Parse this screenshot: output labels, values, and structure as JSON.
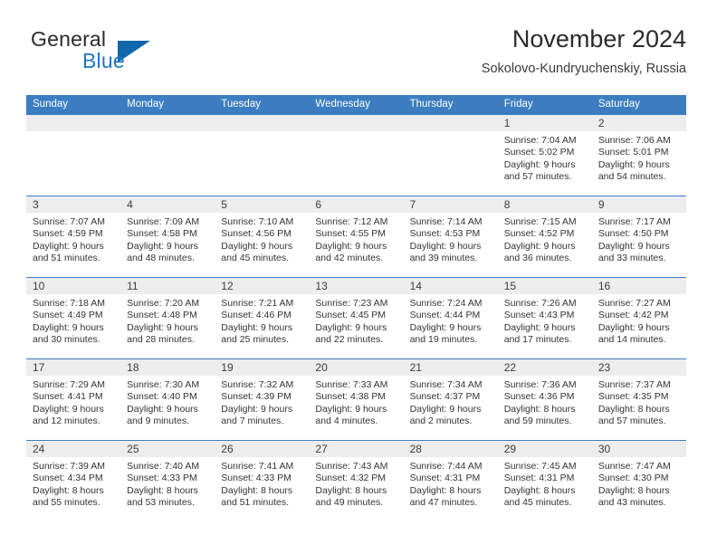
{
  "brand": {
    "word1": "General",
    "word2": "Blue",
    "triangle_color": "#1067ad",
    "blue_text_color": "#1d76c4"
  },
  "header": {
    "title": "November 2024",
    "subtitle": "Sokolovo-Kundryuchenskiy, Russia"
  },
  "calendar": {
    "header_bg": "#3b7dc0",
    "daynum_bg": "#ededed",
    "weekdays": [
      "Sunday",
      "Monday",
      "Tuesday",
      "Wednesday",
      "Thursday",
      "Friday",
      "Saturday"
    ],
    "weeks": [
      [
        {
          "day": "",
          "sunrise": "",
          "sunset": "",
          "daylight1": "",
          "daylight2": ""
        },
        {
          "day": "",
          "sunrise": "",
          "sunset": "",
          "daylight1": "",
          "daylight2": ""
        },
        {
          "day": "",
          "sunrise": "",
          "sunset": "",
          "daylight1": "",
          "daylight2": ""
        },
        {
          "day": "",
          "sunrise": "",
          "sunset": "",
          "daylight1": "",
          "daylight2": ""
        },
        {
          "day": "",
          "sunrise": "",
          "sunset": "",
          "daylight1": "",
          "daylight2": ""
        },
        {
          "day": "1",
          "sunrise": "Sunrise: 7:04 AM",
          "sunset": "Sunset: 5:02 PM",
          "daylight1": "Daylight: 9 hours",
          "daylight2": "and 57 minutes."
        },
        {
          "day": "2",
          "sunrise": "Sunrise: 7:06 AM",
          "sunset": "Sunset: 5:01 PM",
          "daylight1": "Daylight: 9 hours",
          "daylight2": "and 54 minutes."
        }
      ],
      [
        {
          "day": "3",
          "sunrise": "Sunrise: 7:07 AM",
          "sunset": "Sunset: 4:59 PM",
          "daylight1": "Daylight: 9 hours",
          "daylight2": "and 51 minutes."
        },
        {
          "day": "4",
          "sunrise": "Sunrise: 7:09 AM",
          "sunset": "Sunset: 4:58 PM",
          "daylight1": "Daylight: 9 hours",
          "daylight2": "and 48 minutes."
        },
        {
          "day": "5",
          "sunrise": "Sunrise: 7:10 AM",
          "sunset": "Sunset: 4:56 PM",
          "daylight1": "Daylight: 9 hours",
          "daylight2": "and 45 minutes."
        },
        {
          "day": "6",
          "sunrise": "Sunrise: 7:12 AM",
          "sunset": "Sunset: 4:55 PM",
          "daylight1": "Daylight: 9 hours",
          "daylight2": "and 42 minutes."
        },
        {
          "day": "7",
          "sunrise": "Sunrise: 7:14 AM",
          "sunset": "Sunset: 4:53 PM",
          "daylight1": "Daylight: 9 hours",
          "daylight2": "and 39 minutes."
        },
        {
          "day": "8",
          "sunrise": "Sunrise: 7:15 AM",
          "sunset": "Sunset: 4:52 PM",
          "daylight1": "Daylight: 9 hours",
          "daylight2": "and 36 minutes."
        },
        {
          "day": "9",
          "sunrise": "Sunrise: 7:17 AM",
          "sunset": "Sunset: 4:50 PM",
          "daylight1": "Daylight: 9 hours",
          "daylight2": "and 33 minutes."
        }
      ],
      [
        {
          "day": "10",
          "sunrise": "Sunrise: 7:18 AM",
          "sunset": "Sunset: 4:49 PM",
          "daylight1": "Daylight: 9 hours",
          "daylight2": "and 30 minutes."
        },
        {
          "day": "11",
          "sunrise": "Sunrise: 7:20 AM",
          "sunset": "Sunset: 4:48 PM",
          "daylight1": "Daylight: 9 hours",
          "daylight2": "and 28 minutes."
        },
        {
          "day": "12",
          "sunrise": "Sunrise: 7:21 AM",
          "sunset": "Sunset: 4:46 PM",
          "daylight1": "Daylight: 9 hours",
          "daylight2": "and 25 minutes."
        },
        {
          "day": "13",
          "sunrise": "Sunrise: 7:23 AM",
          "sunset": "Sunset: 4:45 PM",
          "daylight1": "Daylight: 9 hours",
          "daylight2": "and 22 minutes."
        },
        {
          "day": "14",
          "sunrise": "Sunrise: 7:24 AM",
          "sunset": "Sunset: 4:44 PM",
          "daylight1": "Daylight: 9 hours",
          "daylight2": "and 19 minutes."
        },
        {
          "day": "15",
          "sunrise": "Sunrise: 7:26 AM",
          "sunset": "Sunset: 4:43 PM",
          "daylight1": "Daylight: 9 hours",
          "daylight2": "and 17 minutes."
        },
        {
          "day": "16",
          "sunrise": "Sunrise: 7:27 AM",
          "sunset": "Sunset: 4:42 PM",
          "daylight1": "Daylight: 9 hours",
          "daylight2": "and 14 minutes."
        }
      ],
      [
        {
          "day": "17",
          "sunrise": "Sunrise: 7:29 AM",
          "sunset": "Sunset: 4:41 PM",
          "daylight1": "Daylight: 9 hours",
          "daylight2": "and 12 minutes."
        },
        {
          "day": "18",
          "sunrise": "Sunrise: 7:30 AM",
          "sunset": "Sunset: 4:40 PM",
          "daylight1": "Daylight: 9 hours",
          "daylight2": "and 9 minutes."
        },
        {
          "day": "19",
          "sunrise": "Sunrise: 7:32 AM",
          "sunset": "Sunset: 4:39 PM",
          "daylight1": "Daylight: 9 hours",
          "daylight2": "and 7 minutes."
        },
        {
          "day": "20",
          "sunrise": "Sunrise: 7:33 AM",
          "sunset": "Sunset: 4:38 PM",
          "daylight1": "Daylight: 9 hours",
          "daylight2": "and 4 minutes."
        },
        {
          "day": "21",
          "sunrise": "Sunrise: 7:34 AM",
          "sunset": "Sunset: 4:37 PM",
          "daylight1": "Daylight: 9 hours",
          "daylight2": "and 2 minutes."
        },
        {
          "day": "22",
          "sunrise": "Sunrise: 7:36 AM",
          "sunset": "Sunset: 4:36 PM",
          "daylight1": "Daylight: 8 hours",
          "daylight2": "and 59 minutes."
        },
        {
          "day": "23",
          "sunrise": "Sunrise: 7:37 AM",
          "sunset": "Sunset: 4:35 PM",
          "daylight1": "Daylight: 8 hours",
          "daylight2": "and 57 minutes."
        }
      ],
      [
        {
          "day": "24",
          "sunrise": "Sunrise: 7:39 AM",
          "sunset": "Sunset: 4:34 PM",
          "daylight1": "Daylight: 8 hours",
          "daylight2": "and 55 minutes."
        },
        {
          "day": "25",
          "sunrise": "Sunrise: 7:40 AM",
          "sunset": "Sunset: 4:33 PM",
          "daylight1": "Daylight: 8 hours",
          "daylight2": "and 53 minutes."
        },
        {
          "day": "26",
          "sunrise": "Sunrise: 7:41 AM",
          "sunset": "Sunset: 4:33 PM",
          "daylight1": "Daylight: 8 hours",
          "daylight2": "and 51 minutes."
        },
        {
          "day": "27",
          "sunrise": "Sunrise: 7:43 AM",
          "sunset": "Sunset: 4:32 PM",
          "daylight1": "Daylight: 8 hours",
          "daylight2": "and 49 minutes."
        },
        {
          "day": "28",
          "sunrise": "Sunrise: 7:44 AM",
          "sunset": "Sunset: 4:31 PM",
          "daylight1": "Daylight: 8 hours",
          "daylight2": "and 47 minutes."
        },
        {
          "day": "29",
          "sunrise": "Sunrise: 7:45 AM",
          "sunset": "Sunset: 4:31 PM",
          "daylight1": "Daylight: 8 hours",
          "daylight2": "and 45 minutes."
        },
        {
          "day": "30",
          "sunrise": "Sunrise: 7:47 AM",
          "sunset": "Sunset: 4:30 PM",
          "daylight1": "Daylight: 8 hours",
          "daylight2": "and 43 minutes."
        }
      ]
    ]
  }
}
